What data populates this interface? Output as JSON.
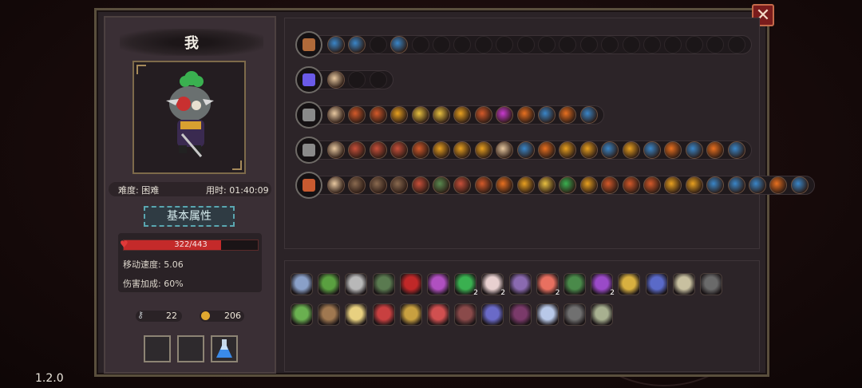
{
  "version": "1.2.0",
  "player": {
    "name": "我",
    "difficulty": "难度: 困难",
    "time": "用时: 01:40:09"
  },
  "attributes": {
    "button_label": "基本属性",
    "hp_text": "322/443",
    "hp_fraction": 0.727,
    "move_speed": "移动速度: 5.06",
    "damage_bonus": "伤害加成: 60%"
  },
  "currency": {
    "keys": "22",
    "coins": "206"
  },
  "close_symbol": "✕",
  "colors": {
    "hp": "#c42a2a",
    "accent_teal": "#5aa6b0",
    "frame_gold": "#7d6a4a"
  },
  "weapon_rows": [
    {
      "weapon": "chest-icon",
      "chips": [
        "#3a86c8",
        "#3a86c8",
        "#222",
        "#3a86c8",
        "#222",
        "#222",
        "#222",
        "#222",
        "#222",
        "#222",
        "#222",
        "#222",
        "#222",
        "#222",
        "#222",
        "#222",
        "#222",
        "#222",
        "#222",
        "#222"
      ]
    },
    {
      "weapon": "orb-icon",
      "chips": [
        "#e8c8a0",
        "#222",
        "#222"
      ]
    },
    {
      "weapon": "dark-sword-icon",
      "chips": [
        "#e8c8a0",
        "#d45a2a",
        "#d45a2a",
        "#e8a020",
        "#e8c040",
        "#e8c040",
        "#e8a020",
        "#d45a2a",
        "#c83ad0",
        "#e87020",
        "#3a86c8",
        "#e87020",
        "#3a86c8"
      ]
    },
    {
      "weapon": "great-axe-icon",
      "chips": [
        "#e8c8a0",
        "#c8503a",
        "#c8503a",
        "#c8503a",
        "#d45a2a",
        "#e8a020",
        "#e8a020",
        "#e8a020",
        "#e8c8a0",
        "#3a86c8",
        "#e87020",
        "#e8a020",
        "#e8a020",
        "#3a86c8",
        "#e8a020",
        "#3a86c8",
        "#e87020",
        "#3a86c8",
        "#e87020",
        "#3a86c8"
      ]
    },
    {
      "weapon": "flame-blade-icon",
      "chips": [
        "#e8c8a0",
        "#8a6a50",
        "#8a6a50",
        "#8a6a50",
        "#c8503a",
        "#5a8a50",
        "#c8503a",
        "#d45a2a",
        "#e87020",
        "#e8a020",
        "#e8c040",
        "#3ab050",
        "#e8a020",
        "#d45a2a",
        "#d45a2a",
        "#d45a2a",
        "#e8a020",
        "#e8a020",
        "#3a86c8",
        "#3a86c8",
        "#3a86c8",
        "#e87020",
        "#3a86c8"
      ]
    }
  ],
  "items": [
    {
      "icon": "shield-crest-icon",
      "color": "#8aa0c8",
      "count": ""
    },
    {
      "icon": "green-blob-icon",
      "color": "#5aa040",
      "count": ""
    },
    {
      "icon": "armor-icon",
      "color": "#b8b8b8",
      "count": ""
    },
    {
      "icon": "belt-icon",
      "color": "#5a7a50",
      "count": ""
    },
    {
      "icon": "red-eye-icon",
      "color": "#c02828",
      "count": ""
    },
    {
      "icon": "rainbow-icon",
      "color": "#b050c0",
      "count": ""
    },
    {
      "icon": "clover-icon",
      "color": "#3ab050",
      "count": "2"
    },
    {
      "icon": "feather-icon",
      "color": "#e8d0d0",
      "count": "2"
    },
    {
      "icon": "rune-tablet-icon",
      "color": "#8a6ab0",
      "count": ""
    },
    {
      "icon": "heart-icon",
      "color": "#e87060",
      "count": "2"
    },
    {
      "icon": "green-boot-icon",
      "color": "#4a8a4a",
      "count": ""
    },
    {
      "icon": "purple-boot-icon",
      "color": "#9a4ac8",
      "count": "2"
    },
    {
      "icon": "gauntlet-icon",
      "color": "#d8b040",
      "count": ""
    },
    {
      "icon": "guitar-icon",
      "color": "#5a6ac8",
      "count": ""
    },
    {
      "icon": "wand-icon",
      "color": "#c8c0a0",
      "count": ""
    },
    {
      "icon": "cloak-icon",
      "color": "#6a6a6a",
      "count": ""
    },
    {
      "icon": "leaf-icon",
      "color": "#6ab050",
      "count": ""
    },
    {
      "icon": "mask-icon",
      "color": "#a07850",
      "count": ""
    },
    {
      "icon": "horn-icon",
      "color": "#e8d080",
      "count": ""
    },
    {
      "icon": "amulet-icon",
      "color": "#c84040",
      "count": ""
    },
    {
      "icon": "book-icon",
      "color": "#c8a040",
      "count": ""
    },
    {
      "icon": "fish-icon",
      "color": "#d05050",
      "count": ""
    },
    {
      "icon": "vest-icon",
      "color": "#8a4a4a",
      "count": ""
    },
    {
      "icon": "jellyfish-icon",
      "color": "#6a6ac8",
      "count": ""
    },
    {
      "icon": "scarf-icon",
      "color": "#7a3a6a",
      "count": ""
    },
    {
      "icon": "lotus-icon",
      "color": "#b8c8e8",
      "count": ""
    },
    {
      "icon": "helmet-icon",
      "color": "#707070",
      "count": ""
    },
    {
      "icon": "staff-icon",
      "color": "#a8b090",
      "count": ""
    }
  ]
}
